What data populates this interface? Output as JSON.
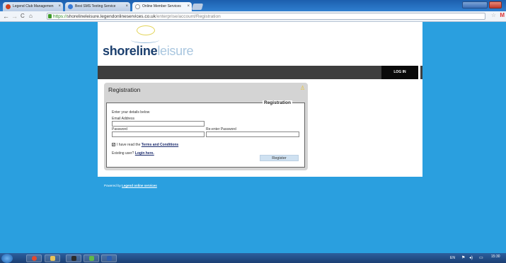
{
  "browser": {
    "tabs": [
      {
        "title": "Legend Club Managemen",
        "favicon_color": "#d04020"
      },
      {
        "title": "Best SMS Texting Service",
        "favicon_color": "#3a7bd5"
      },
      {
        "title": "Online Member Services",
        "favicon_color": "#ffffff"
      }
    ],
    "url": {
      "scheme": "https://",
      "host": "shorelineleisure.legendonlineservices.co.uk",
      "path": "/enterprise/account/Registration"
    }
  },
  "site": {
    "logo_bold": "shoreline",
    "logo_light": "leisure",
    "nav_login": "LOG IN",
    "footer_prefix": "Powered by",
    "footer_link": "Legend online services"
  },
  "registration": {
    "title": "Registration",
    "legend": "Registration",
    "intro": "Enter your details below",
    "email_label": "Email Address",
    "email_value": "",
    "password_label": "Password",
    "password_value": "",
    "reenter_label": "Re-enter Password",
    "reenter_value": "",
    "terms_prefix": "I have read the",
    "terms_link": "Terms and Conditions",
    "terms_checked": true,
    "existing_prefix": "Existing user?",
    "login_link": "Login here.",
    "register_button": "Register"
  },
  "taskbar": {
    "language": "EN",
    "time": "15:30"
  },
  "colors": {
    "background": "#2a9fdf",
    "navbar": "#3d3d3d",
    "logo_dark": "#1b3f6e",
    "logo_light": "#a9c6df",
    "register_button": "#cfe1f1"
  }
}
